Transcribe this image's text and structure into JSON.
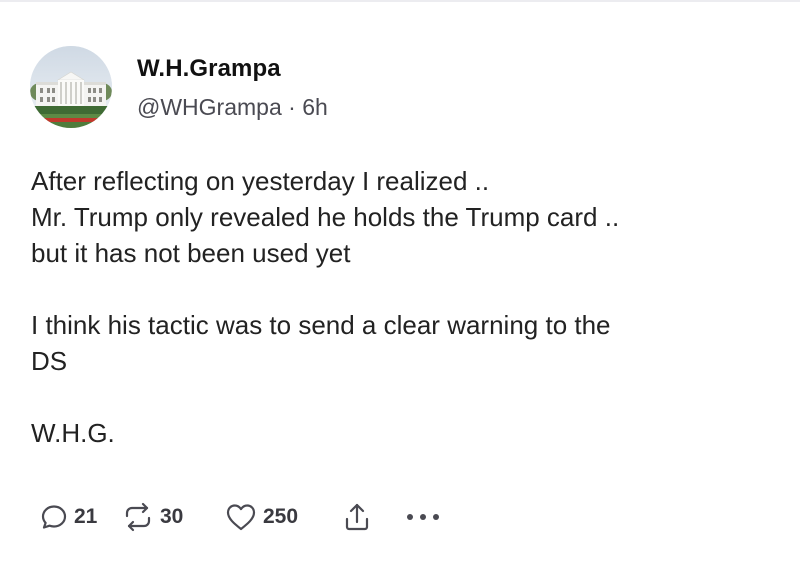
{
  "author": {
    "name": "W.H.Grampa",
    "handle": "@WHGrampa",
    "separator": " · ",
    "time": "6h"
  },
  "avatar": {
    "icon": "white-house-avatar"
  },
  "post": {
    "paragraphs": [
      {
        "lines": [
          "After reflecting on yesterday I realized ..",
          "Mr. Trump only revealed he holds the Trump card ..",
          "but it has not been used yet"
        ]
      },
      {
        "lines": [
          "I think his tactic was to send a clear warning to the",
          "DS"
        ]
      },
      {
        "lines": [
          "W.H.G."
        ]
      }
    ]
  },
  "actions": {
    "reply": {
      "icon": "reply-icon",
      "count": "21"
    },
    "repost": {
      "icon": "repost-icon",
      "count": "30"
    },
    "like": {
      "icon": "heart-icon",
      "count": "250"
    },
    "share": {
      "icon": "share-icon"
    },
    "more": {
      "icon": "more-icon"
    }
  },
  "colors": {
    "text": "#222222",
    "muted": "#4a4a52",
    "background": "#ffffff"
  }
}
